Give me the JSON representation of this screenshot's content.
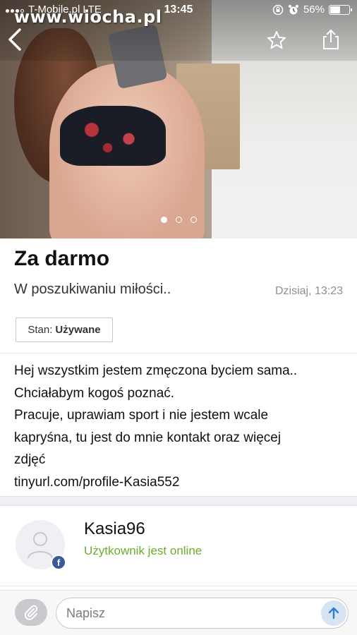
{
  "status_bar": {
    "carrier": "T-Mobile.pl",
    "network": "LTE",
    "time": "13:45",
    "battery": "56%",
    "battery_level": 0.56
  },
  "watermark": "www.wiocha.pl",
  "gallery": {
    "image_count": 3,
    "active_index": 0
  },
  "listing": {
    "title": "Za darmo",
    "subtitle": "W poszukiwaniu miłości..",
    "date": "Dzisiaj, 13:23",
    "condition_label": "Stan:",
    "condition_value": "Używane",
    "description_lines": [
      "Hej wszystkim jestem zmęczona byciem sama..",
      "Chciałabym kogoś poznać.",
      "Pracuje, uprawiam sport i nie jestem wcale",
      "kapryśna, tu jest do mnie kontakt oraz więcej",
      "zdjęć",
      "tinyurl.com/profile-Kasia552"
    ]
  },
  "seller": {
    "name": "Kasia96",
    "status": "Użytkownik jest online",
    "badge": "f"
  },
  "composer": {
    "placeholder": "Napisz"
  },
  "icons": {
    "back": "chevron-left-icon",
    "favorite": "star-icon",
    "share": "share-icon",
    "attach": "paperclip-icon",
    "send": "arrow-up-icon"
  },
  "colors": {
    "online": "#6cae2c",
    "facebook": "#3b5998",
    "send_button": "#d6e4f3"
  }
}
